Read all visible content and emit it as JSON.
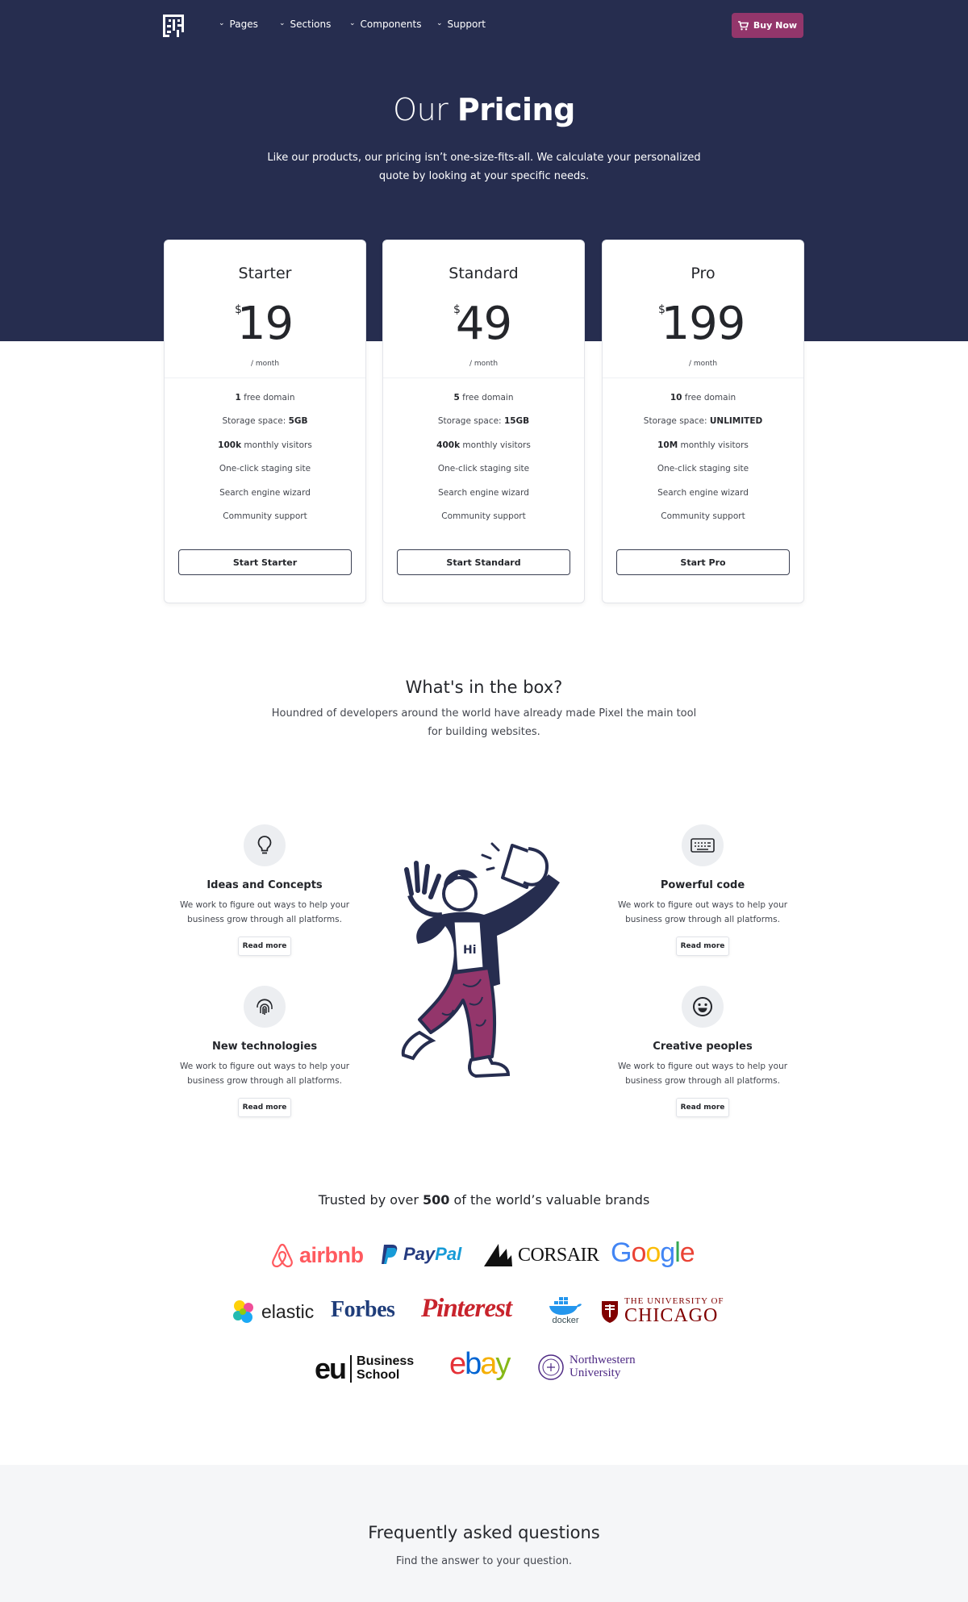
{
  "nav": {
    "items": [
      {
        "label": "Pages"
      },
      {
        "label": "Sections"
      },
      {
        "label": "Components"
      },
      {
        "label": "Support"
      }
    ],
    "buy_label": "Buy Now"
  },
  "hero": {
    "title_light": "Our",
    "title_bold": "Pricing",
    "subtitle": "Like our products, our pricing isn’t one-size-fits-all. We calculate your personalized quote by looking at your specific needs."
  },
  "plans": [
    {
      "name": "Starter",
      "currency": "$",
      "price": "19",
      "period": "/ month",
      "features": [
        {
          "bold": "1",
          "text": " free domain"
        },
        {
          "text": "Storage space: ",
          "bold_after": "5GB"
        },
        {
          "bold": "100k",
          "text": " monthly visitors"
        },
        {
          "text": "One-click staging site"
        },
        {
          "text": "Search engine wizard"
        },
        {
          "text": "Community support"
        }
      ],
      "button": "Start Starter"
    },
    {
      "name": "Standard",
      "currency": "$",
      "price": "49",
      "period": "/ month",
      "features": [
        {
          "bold": "5",
          "text": " free domain"
        },
        {
          "text": "Storage space: ",
          "bold_after": "15GB"
        },
        {
          "bold": "400k",
          "text": " monthly visitors"
        },
        {
          "text": "One-click staging site"
        },
        {
          "text": "Search engine wizard"
        },
        {
          "text": "Community support"
        }
      ],
      "button": "Start Standard"
    },
    {
      "name": "Pro",
      "currency": "$",
      "price": "199",
      "period": "/ month",
      "features": [
        {
          "bold": "10",
          "text": " free domain"
        },
        {
          "text": "Storage space: ",
          "bold_after": "UNLIMITED"
        },
        {
          "bold": "10M",
          "text": " monthly visitors"
        },
        {
          "text": "One-click staging site"
        },
        {
          "text": "Search engine wizard"
        },
        {
          "text": "Community support"
        }
      ],
      "button": "Start Pro"
    }
  ],
  "box": {
    "title": "What's in the box?",
    "subtitle": "Houndred of developers around the world have already made Pixel the main tool for building websites.",
    "features": [
      {
        "icon": "lightbulb-icon",
        "title": "Ideas and Concepts",
        "text": "We work to figure out ways to help your business grow through all platforms.",
        "button": "Read more"
      },
      {
        "icon": "fingerprint-icon",
        "title": "New technologies",
        "text": "We work to figure out ways to help your business grow through all platforms.",
        "button": "Read more"
      },
      {
        "icon": "keyboard-icon",
        "title": "Powerful code",
        "text": "We work to figure out ways to help your business grow through all platforms.",
        "button": "Read more"
      },
      {
        "icon": "smiley-icon",
        "title": "Creative peoples",
        "text": "We work to figure out ways to help your business grow through all platforms.",
        "button": "Read more"
      }
    ],
    "illustration_text": "Hi"
  },
  "brands": {
    "title_before": "Trusted by over ",
    "title_bold": "500",
    "title_after": " of the world’s valuable brands",
    "logos": {
      "airbnb": "airbnb",
      "paypal_1": "Pay",
      "paypal_2": "Pal",
      "corsair": "CORSAIR",
      "google": [
        "G",
        "o",
        "o",
        "g",
        "l",
        "e"
      ],
      "elastic": "elastic",
      "forbes": "Forbes",
      "pinterest": "Pinterest",
      "docker": "docker",
      "chicago_1": "THE UNIVERSITY OF",
      "chicago_2": "CHICAGO",
      "eu": "eu",
      "eu_line1": "Business",
      "eu_line2": "School",
      "ebay": [
        "e",
        "b",
        "a",
        "y"
      ],
      "northwestern_1": "Northwestern",
      "northwestern_2": "University"
    },
    "colors": {
      "airbnb": "#ff5a5f",
      "paypal_dark": "#253b80",
      "paypal_light": "#179bd7",
      "google": [
        "#4285f4",
        "#ea4335",
        "#fbbc05",
        "#4285f4",
        "#34a853",
        "#ea4335"
      ],
      "forbes": "#1f3d7a",
      "pinterest": "#c8232c",
      "docker": "#2496ed",
      "chicago": "#800000",
      "ebay": [
        "#e53238",
        "#0064d2",
        "#f5af02",
        "#86b817"
      ],
      "northwestern": "#4e2a84"
    }
  },
  "faq": {
    "title": "Frequently asked questions",
    "subtitle": "Find the answer to your question."
  }
}
